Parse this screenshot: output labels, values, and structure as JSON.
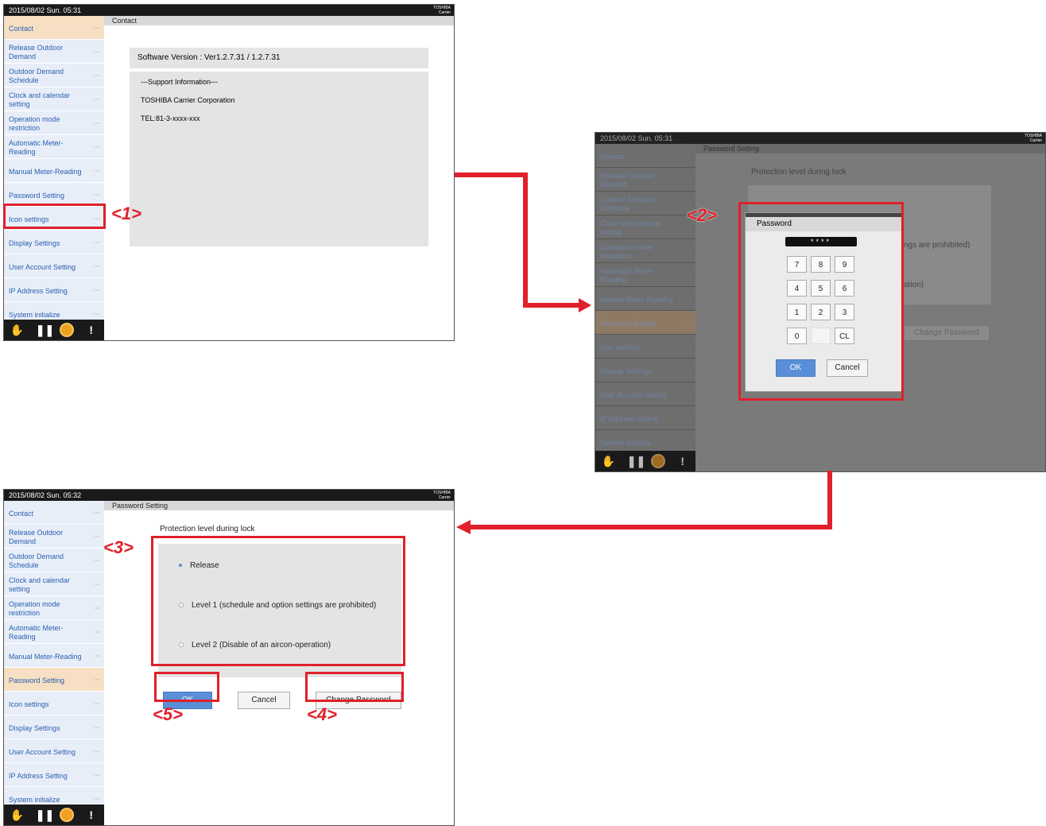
{
  "screen1": {
    "datetime": "2015/08/02  Sun.  05:31",
    "brand_line1": "TOSHIBA",
    "brand_line2": "Carrier",
    "title": "Contact",
    "software_version": "Software Version : Ver1.2.7.31 / 1.2.7.31",
    "support_header": "---Support Information---",
    "support_company": "TOSHIBA Carrier Corporation",
    "support_tel": "TEL:81-3-xxxx-xxx"
  },
  "screen2": {
    "datetime": "2015/08/02  Sun.  05:31",
    "brand_line1": "TOSHIBA",
    "brand_line2": "Carrier",
    "title": "Password Setting",
    "protection_label": "Protection level during lock",
    "bg_level1_tail": "ngs are prohibited)",
    "bg_level2_tail": "ation)",
    "bg_change_password": "Change Password",
    "dialog_title": "Password",
    "password_mask": "****",
    "keys": [
      "7",
      "8",
      "9",
      "4",
      "5",
      "6",
      "1",
      "2",
      "3",
      "0",
      "",
      "CL"
    ],
    "ok": "OK",
    "cancel": "Cancel"
  },
  "screen3": {
    "datetime": "2015/08/02  Sun.  05:32",
    "brand_line1": "TOSHIBA",
    "brand_line2": "Carrier",
    "title": "Password Setting",
    "protection_label": "Protection level during lock",
    "options": [
      {
        "label": "Release",
        "selected": true
      },
      {
        "label": "Level 1 (schedule and option settings are prohibited)",
        "selected": false
      },
      {
        "label": "Level 2 (Disable of an aircon-operation)",
        "selected": false
      }
    ],
    "ok": "OK",
    "cancel": "Cancel",
    "change_password": "Change Password"
  },
  "sidebar": {
    "items": [
      "Contact",
      "Release Outdoor Demand",
      "Outdoor Demand Schedule",
      "Clock and calendar setting",
      "Operation mode restriction",
      "Automatic Meter-Reading",
      "Manual Meter-Reading",
      "Password Setting",
      "Icon settings",
      "Display Settings",
      "User Account Setting",
      "IP Address Setting",
      "System initialize"
    ],
    "dots": "···"
  },
  "callouts": {
    "c1": "<1>",
    "c2": "<2>",
    "c3": "<3>",
    "c4": "<4>",
    "c5": "<5>"
  },
  "colors": {
    "annotation_red": "#e0202a",
    "ok_blue": "#5a8fd8",
    "active_item": "#f6dfc2"
  }
}
